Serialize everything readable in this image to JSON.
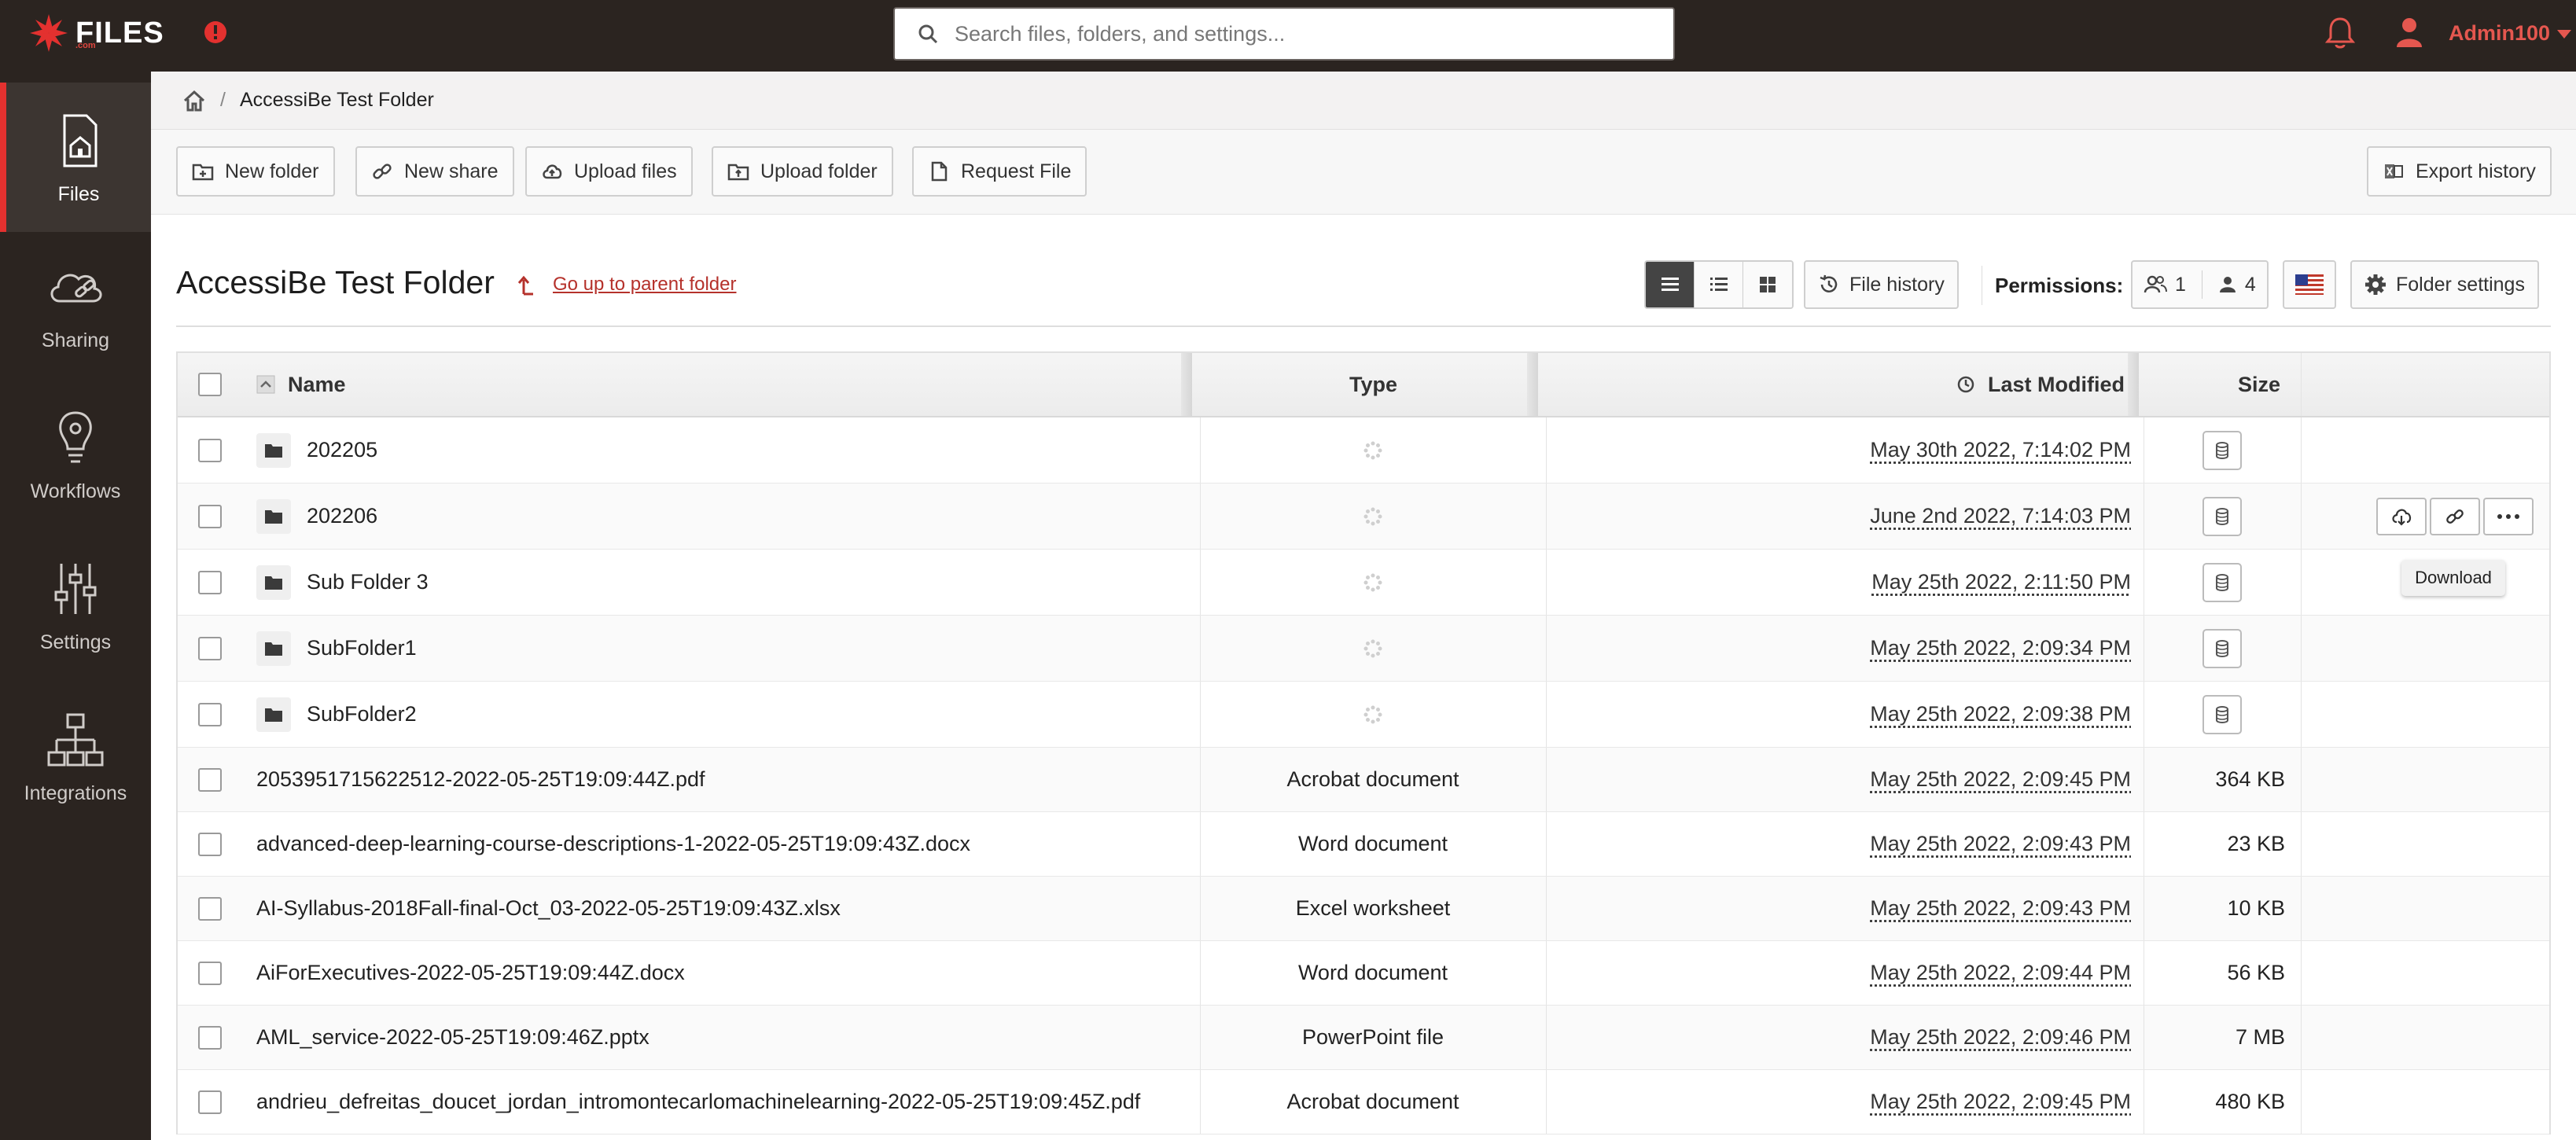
{
  "app": {
    "logo_text": "FILES",
    "logo_sub": ".com",
    "search_placeholder": "Search files, folders, and settings...",
    "username": "Admin100",
    "accent_color": "#e3312f"
  },
  "sidebar": {
    "items": [
      {
        "label": "Files",
        "icon": "home-document-icon",
        "active": true
      },
      {
        "label": "Sharing",
        "icon": "cloud-link-icon"
      },
      {
        "label": "Workflows",
        "icon": "lightbulb-icon"
      },
      {
        "label": "Settings",
        "icon": "sliders-icon"
      },
      {
        "label": "Integrations",
        "icon": "network-icon"
      }
    ]
  },
  "breadcrumb": {
    "current": "AccessiBe Test Folder",
    "separator": "/"
  },
  "toolbar": {
    "new_folder": "New folder",
    "new_share": "New share",
    "upload_files": "Upload files",
    "upload_folder": "Upload folder",
    "request_file": "Request File",
    "export_history": "Export history"
  },
  "folder": {
    "title": "AccessiBe Test Folder",
    "parent_link": "Go up to parent folder",
    "file_history": "File history",
    "permissions_label": "Permissions:",
    "group_count": "1",
    "user_count": "4",
    "folder_settings": "Folder settings"
  },
  "table": {
    "headers": {
      "name": "Name",
      "type": "Type",
      "modified": "Last Modified",
      "size": "Size"
    },
    "rows": [
      {
        "name": "202205",
        "folder": true,
        "type": "",
        "modified": "May 30th 2022, 7:14:02 PM",
        "size": ""
      },
      {
        "name": "202206",
        "folder": true,
        "type": "",
        "modified": "June 2nd 2022, 7:14:03 PM",
        "size": "",
        "hovered": true
      },
      {
        "name": "Sub Folder 3",
        "folder": true,
        "type": "",
        "modified": "May 25th 2022, 2:11:50 PM",
        "size": ""
      },
      {
        "name": "SubFolder1",
        "folder": true,
        "type": "",
        "modified": "May 25th 2022, 2:09:34 PM",
        "size": ""
      },
      {
        "name": "SubFolder2",
        "folder": true,
        "type": "",
        "modified": "May 25th 2022, 2:09:38 PM",
        "size": ""
      },
      {
        "name": "2053951715622512-2022-05-25T19:09:44Z.pdf",
        "folder": false,
        "type": "Acrobat document",
        "modified": "May 25th 2022, 2:09:45 PM",
        "size": "364 KB"
      },
      {
        "name": "advanced-deep-learning-course-descriptions-1-2022-05-25T19:09:43Z.docx",
        "folder": false,
        "type": "Word document",
        "modified": "May 25th 2022, 2:09:43 PM",
        "size": "23 KB"
      },
      {
        "name": "AI-Syllabus-2018Fall-final-Oct_03-2022-05-25T19:09:43Z.xlsx",
        "folder": false,
        "type": "Excel worksheet",
        "modified": "May 25th 2022, 2:09:43 PM",
        "size": "10 KB"
      },
      {
        "name": "AiForExecutives-2022-05-25T19:09:44Z.docx",
        "folder": false,
        "type": "Word document",
        "modified": "May 25th 2022, 2:09:44 PM",
        "size": "56 KB"
      },
      {
        "name": "AML_service-2022-05-25T19:09:46Z.pptx",
        "folder": false,
        "type": "PowerPoint file",
        "modified": "May 25th 2022, 2:09:46 PM",
        "size": "7 MB"
      },
      {
        "name": "andrieu_defreitas_doucet_jordan_intromontecarlomachinelearning-2022-05-25T19:09:45Z.pdf",
        "folder": false,
        "type": "Acrobat document",
        "modified": "May 25th 2022, 2:09:45 PM",
        "size": "480 KB"
      }
    ]
  },
  "tooltip": {
    "text": "Download"
  }
}
